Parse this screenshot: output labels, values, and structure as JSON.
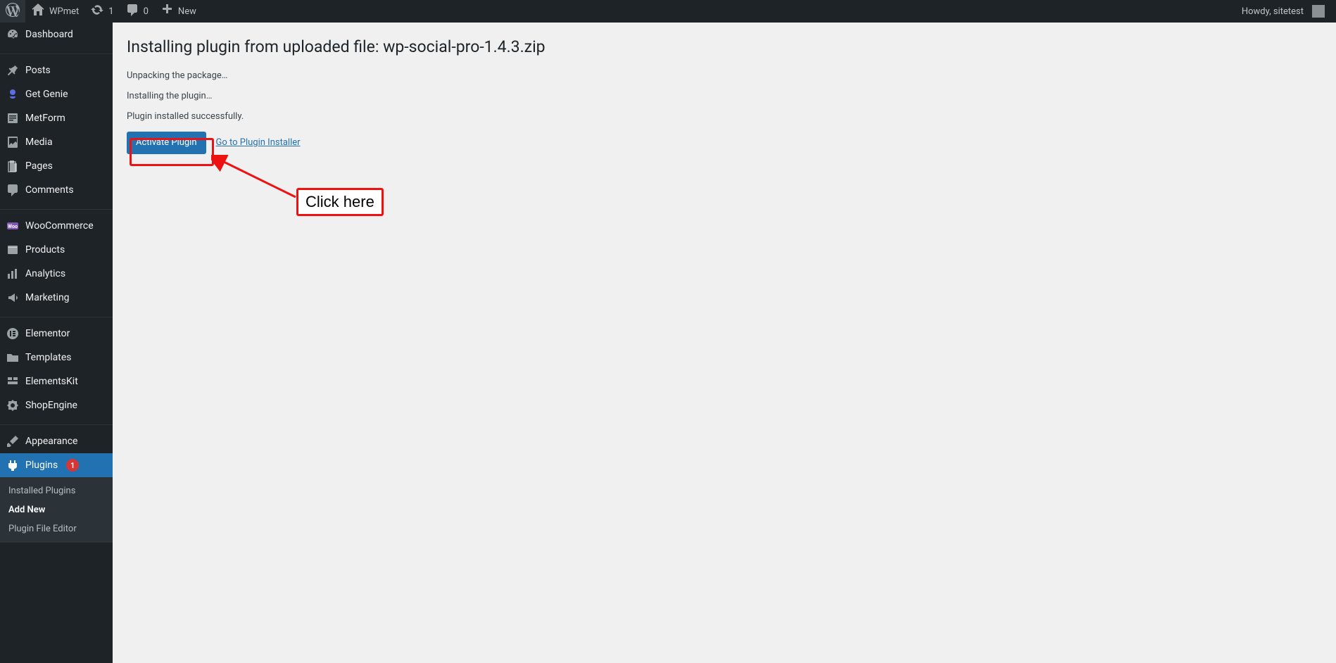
{
  "adminbar": {
    "site_name": "WPmet",
    "updates_count": "1",
    "comments_count": "0",
    "new_label": "New",
    "howdy": "Howdy, sitetest"
  },
  "sidebar": {
    "items": [
      {
        "label": "Dashboard"
      },
      {
        "label": "Posts"
      },
      {
        "label": "Get Genie"
      },
      {
        "label": "MetForm"
      },
      {
        "label": "Media"
      },
      {
        "label": "Pages"
      },
      {
        "label": "Comments"
      },
      {
        "label": "WooCommerce"
      },
      {
        "label": "Products"
      },
      {
        "label": "Analytics"
      },
      {
        "label": "Marketing"
      },
      {
        "label": "Elementor"
      },
      {
        "label": "Templates"
      },
      {
        "label": "ElementsKit"
      },
      {
        "label": "ShopEngine"
      },
      {
        "label": "Appearance"
      },
      {
        "label": "Plugins",
        "badge": "1"
      }
    ],
    "submenu": [
      {
        "label": "Installed Plugins"
      },
      {
        "label": "Add New"
      },
      {
        "label": "Plugin File Editor"
      }
    ]
  },
  "page": {
    "title": "Installing plugin from uploaded file: wp-social-pro-1.4.3.zip",
    "line1": "Unpacking the package…",
    "line2": "Installing the plugin…",
    "line3": "Plugin installed successfully.",
    "activate_button": "Activate Plugin",
    "installer_link": "Go to Plugin Installer"
  },
  "annotation": {
    "label": "Click here"
  }
}
